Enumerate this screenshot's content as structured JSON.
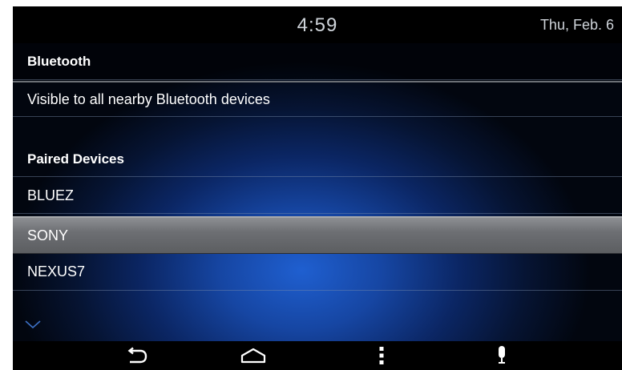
{
  "status": {
    "time": "4:59",
    "date": "Thu, Feb. 6"
  },
  "bluetooth": {
    "title": "Bluetooth",
    "visibility": "Visible to all nearby Bluetooth devices"
  },
  "paired": {
    "title": "Paired Devices",
    "devices": [
      {
        "name": "BLUEZ",
        "selected": false
      },
      {
        "name": "SONY",
        "selected": true
      },
      {
        "name": "NEXUS7",
        "selected": false
      }
    ]
  },
  "icons": {
    "scroll": "chevron-down-icon",
    "back": "back-icon",
    "home": "home-icon",
    "menu": "menu-icon",
    "mic": "microphone-icon"
  },
  "colors": {
    "background_glow": "#1f5fd0",
    "selected_row": "#6d6f73",
    "status_bar": "#000000",
    "status_text": "#cfd4da"
  }
}
